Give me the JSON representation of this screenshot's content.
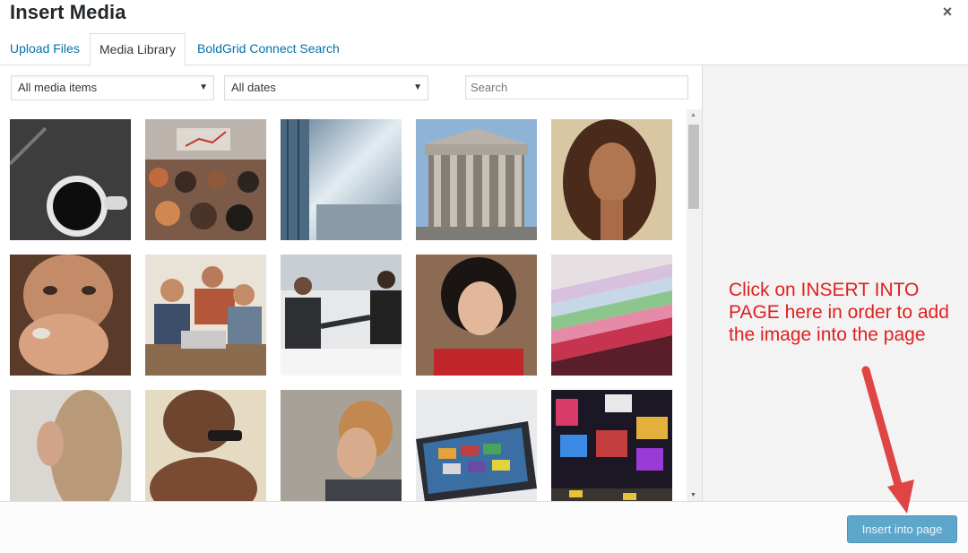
{
  "dialog": {
    "title": "Insert Media",
    "close_glyph": "×"
  },
  "tabs": [
    {
      "label": "Upload Files"
    },
    {
      "label": "Media Library",
      "active": true
    },
    {
      "label": "BoldGrid Connect Search"
    }
  ],
  "filters": {
    "type_value": "All media items",
    "date_value": "All dates",
    "search_placeholder": "Search"
  },
  "media": [
    {
      "name": "coffee-cup-on-dark-desk",
      "icon": "photo"
    },
    {
      "name": "conference-audience",
      "icon": "photo"
    },
    {
      "name": "glass-building-skyline",
      "icon": "photo"
    },
    {
      "name": "classical-columned-building",
      "icon": "photo"
    },
    {
      "name": "woman-portrait-curly-hair",
      "icon": "photo"
    },
    {
      "name": "woman-drinking-from-mug",
      "icon": "photo"
    },
    {
      "name": "team-around-laptop",
      "icon": "photo"
    },
    {
      "name": "business-handshake",
      "icon": "photo"
    },
    {
      "name": "woman-red-top-portrait",
      "icon": "photo"
    },
    {
      "name": "colorful-paper-stack",
      "icon": "photo"
    },
    {
      "name": "blonde-woman-profile",
      "icon": "photo"
    },
    {
      "name": "man-with-scarf-sunglasses",
      "icon": "photo"
    },
    {
      "name": "man-looking-away",
      "icon": "photo"
    },
    {
      "name": "tablet-on-desk",
      "icon": "photo"
    },
    {
      "name": "times-square-night",
      "icon": "photo"
    }
  ],
  "footer": {
    "insert_label": "Insert into page"
  },
  "annotation": {
    "text": "Click on INSERT INTO PAGE here in order to add the image into the page",
    "color": "#e02020"
  },
  "colors": {
    "link": "#0073aa",
    "button": "#5fa6cd",
    "arrow": "#e04545"
  }
}
